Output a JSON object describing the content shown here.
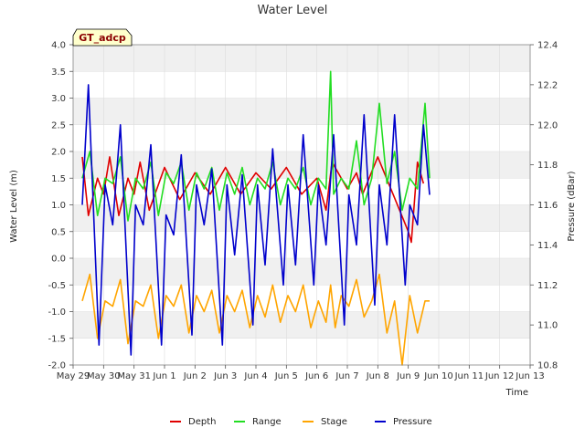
{
  "chart_data": {
    "type": "line",
    "title": "Water Level",
    "site_badge": "GT_adcp",
    "xlabel": "Time",
    "ylabel": "Water Level (m)",
    "y2label": "Pressure (dBar)",
    "ylim": [
      -2.0,
      4.0
    ],
    "y2lim": [
      10.8,
      12.4
    ],
    "yticks": [
      "-2.0",
      "-1.5",
      "-1.0",
      "-0.5",
      "0.0",
      "0.5",
      "1.0",
      "1.5",
      "2.0",
      "2.5",
      "3.0",
      "3.5",
      "4.0"
    ],
    "y2ticks": [
      "10.8",
      "11.0",
      "11.2",
      "11.4",
      "11.6",
      "11.8",
      "12.0",
      "12.2",
      "12.4"
    ],
    "xticks": [
      "May 29",
      "May 30",
      "May 31",
      "Jun 1",
      "Jun 2",
      "Jun 3",
      "Jun 4",
      "Jun 5",
      "Jun 6",
      "Jun 7",
      "Jun 8",
      "Jun 9",
      "Jun 10",
      "Jun 11",
      "Jun 12",
      "Jun 13"
    ],
    "grid": true,
    "legend_position": "bottom",
    "colors": {
      "Depth": "#e00000",
      "Range": "#22dd22",
      "Stage": "#ffa500",
      "Pressure": "#0000cc",
      "band": "#f0f0f0",
      "badge_fill": "#ffffcc"
    },
    "series": [
      {
        "name": "Depth",
        "axis": "left",
        "x": [
          0.3,
          0.5,
          0.8,
          1.0,
          1.2,
          1.5,
          1.8,
          2.0,
          2.2,
          2.5,
          3.0,
          3.5,
          4.0,
          4.5,
          5.0,
          5.5,
          6.0,
          6.5,
          7.0,
          7.5,
          8.0,
          8.3,
          8.5,
          9.0,
          9.3,
          9.5,
          10.0,
          10.5,
          11.0,
          11.1,
          11.3,
          11.5
        ],
        "y": [
          1.9,
          0.8,
          1.5,
          1.2,
          1.9,
          0.8,
          1.5,
          1.2,
          1.8,
          0.9,
          1.7,
          1.1,
          1.6,
          1.2,
          1.7,
          1.2,
          1.6,
          1.3,
          1.7,
          1.2,
          1.5,
          0.9,
          1.8,
          1.3,
          1.6,
          1.2,
          1.9,
          1.2,
          0.5,
          0.3,
          1.8,
          1.4
        ]
      },
      {
        "name": "Range",
        "axis": "left",
        "x": [
          0.3,
          0.55,
          0.8,
          1.05,
          1.3,
          1.55,
          1.8,
          2.05,
          2.3,
          2.55,
          2.8,
          3.05,
          3.3,
          3.55,
          3.8,
          4.05,
          4.3,
          4.55,
          4.8,
          5.05,
          5.3,
          5.55,
          5.8,
          6.05,
          6.3,
          6.55,
          6.8,
          7.05,
          7.3,
          7.55,
          7.8,
          8.05,
          8.3,
          8.45,
          8.55,
          8.8,
          9.05,
          9.3,
          9.55,
          9.8,
          10.05,
          10.3,
          10.55,
          10.8,
          11.05,
          11.3,
          11.55,
          11.7
        ],
        "y": [
          1.5,
          2.0,
          0.8,
          1.5,
          1.4,
          1.9,
          0.7,
          1.5,
          1.3,
          1.8,
          0.8,
          1.6,
          1.4,
          1.8,
          0.9,
          1.6,
          1.3,
          1.7,
          0.9,
          1.6,
          1.2,
          1.7,
          1.0,
          1.5,
          1.3,
          1.8,
          1.0,
          1.5,
          1.3,
          1.7,
          1.0,
          1.5,
          1.3,
          3.5,
          1.2,
          1.5,
          1.3,
          2.2,
          1.0,
          1.5,
          2.9,
          1.4,
          2.0,
          0.9,
          1.5,
          1.3,
          2.9,
          1.5
        ]
      },
      {
        "name": "Stage",
        "axis": "left",
        "x": [
          0.3,
          0.55,
          0.8,
          1.05,
          1.3,
          1.55,
          1.8,
          2.05,
          2.3,
          2.55,
          2.8,
          3.05,
          3.3,
          3.55,
          3.8,
          4.05,
          4.3,
          4.55,
          4.8,
          5.05,
          5.3,
          5.55,
          5.8,
          6.05,
          6.3,
          6.55,
          6.8,
          7.05,
          7.3,
          7.55,
          7.8,
          8.05,
          8.3,
          8.45,
          8.6,
          8.8,
          9.05,
          9.3,
          9.55,
          9.8,
          10.05,
          10.3,
          10.55,
          10.8,
          11.05,
          11.3,
          11.55,
          11.7
        ],
        "y": [
          -0.8,
          -0.3,
          -1.5,
          -0.8,
          -0.9,
          -0.4,
          -1.6,
          -0.8,
          -0.9,
          -0.5,
          -1.5,
          -0.7,
          -0.9,
          -0.5,
          -1.4,
          -0.7,
          -1.0,
          -0.6,
          -1.4,
          -0.7,
          -1.0,
          -0.6,
          -1.3,
          -0.7,
          -1.1,
          -0.5,
          -1.2,
          -0.7,
          -1.0,
          -0.5,
          -1.3,
          -0.8,
          -1.2,
          -0.5,
          -1.3,
          -0.7,
          -0.9,
          -0.4,
          -1.1,
          -0.8,
          -0.3,
          -1.4,
          -0.8,
          -2.0,
          -0.7,
          -1.4,
          -0.8,
          -0.8
        ]
      },
      {
        "name": "Pressure",
        "axis": "right",
        "x": [
          0.3,
          0.5,
          0.85,
          1.05,
          1.3,
          1.55,
          1.9,
          2.05,
          2.3,
          2.55,
          2.9,
          3.05,
          3.3,
          3.55,
          3.9,
          4.05,
          4.3,
          4.55,
          4.9,
          5.05,
          5.3,
          5.55,
          5.9,
          6.05,
          6.3,
          6.55,
          6.9,
          7.05,
          7.3,
          7.55,
          7.9,
          8.05,
          8.3,
          8.55,
          8.9,
          9.05,
          9.3,
          9.55,
          9.9,
          10.05,
          10.3,
          10.55,
          10.9,
          11.05,
          11.3,
          11.5,
          11.7
        ],
        "y": [
          11.6,
          12.2,
          10.9,
          11.7,
          11.5,
          12.0,
          10.85,
          11.6,
          11.5,
          11.9,
          10.9,
          11.55,
          11.45,
          11.85,
          10.95,
          11.7,
          11.5,
          11.78,
          10.9,
          11.7,
          11.35,
          11.75,
          11.0,
          11.7,
          11.3,
          11.88,
          11.2,
          11.7,
          11.3,
          11.95,
          11.2,
          11.7,
          11.4,
          11.95,
          11.0,
          11.65,
          11.4,
          12.05,
          11.1,
          11.7,
          11.4,
          12.05,
          11.2,
          11.6,
          11.5,
          12.0,
          11.65
        ]
      }
    ]
  }
}
